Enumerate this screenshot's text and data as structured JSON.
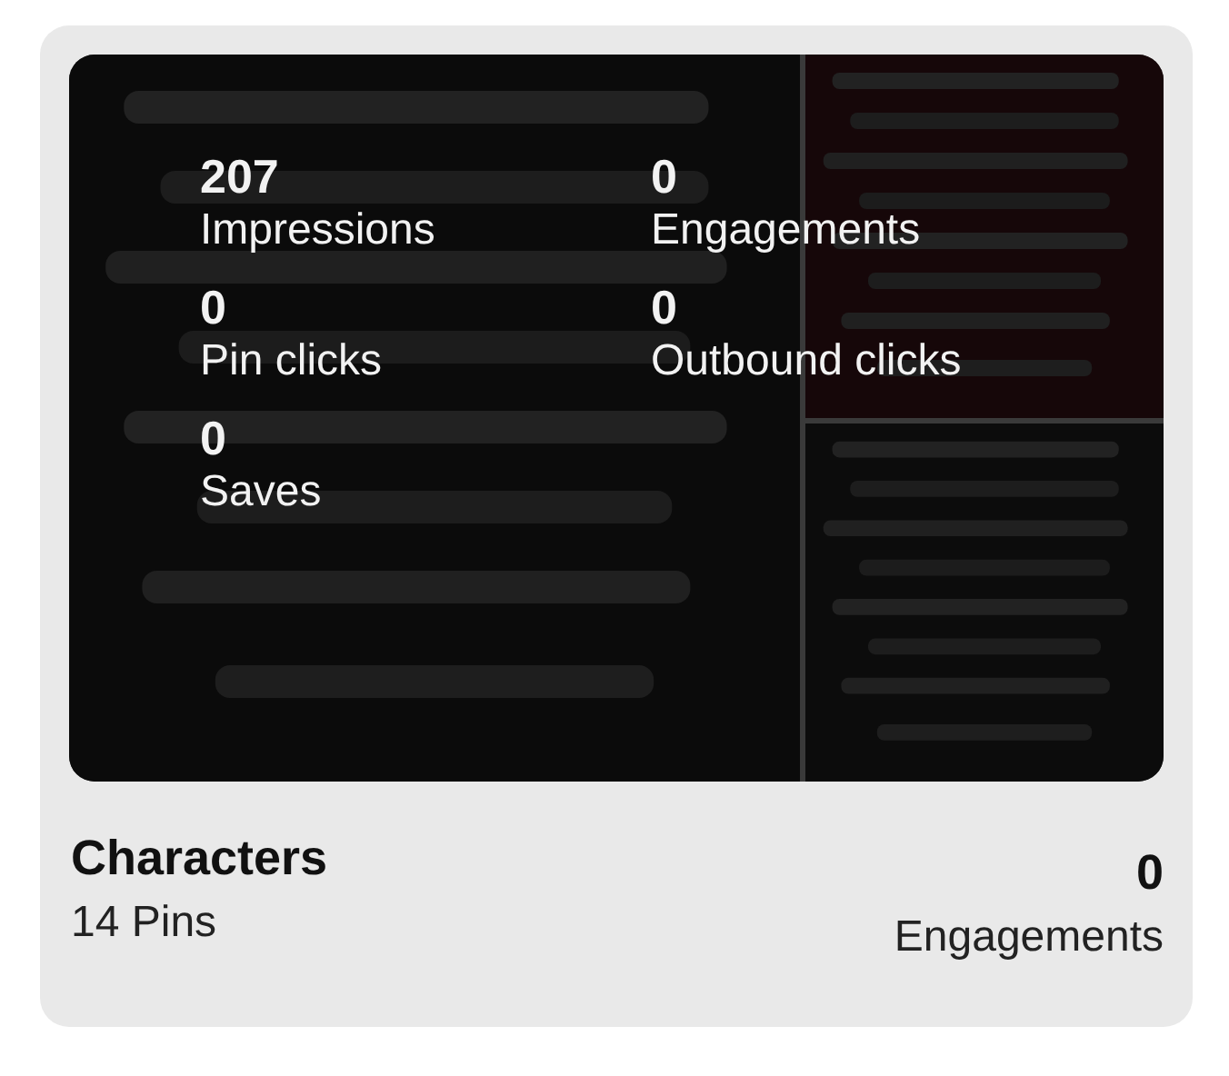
{
  "board": {
    "stats": [
      {
        "value": "207",
        "label": "Impressions"
      },
      {
        "value": "0",
        "label": "Engagements"
      },
      {
        "value": "0",
        "label": "Pin clicks"
      },
      {
        "value": "0",
        "label": "Outbound clicks"
      },
      {
        "value": "0",
        "label": "Saves"
      }
    ],
    "title": "Characters",
    "pins": "14 Pins",
    "engagements_value": "0",
    "engagements_label": "Engagements"
  }
}
